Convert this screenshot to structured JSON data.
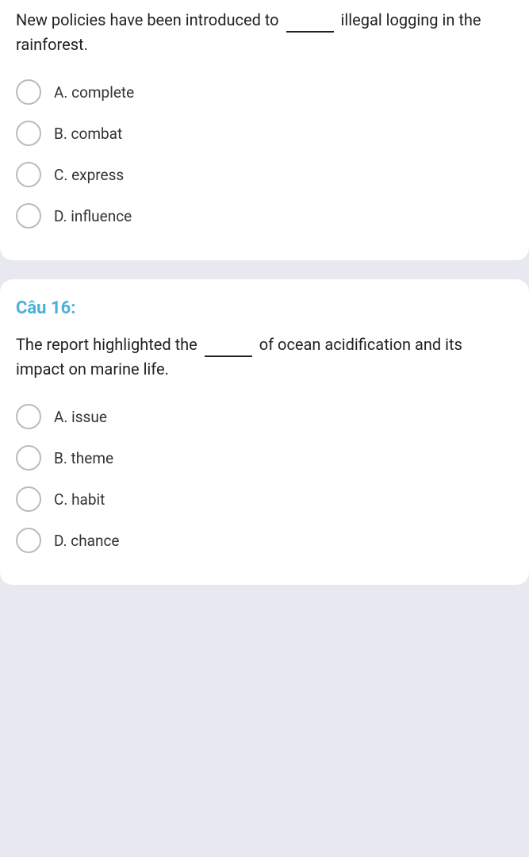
{
  "question15": {
    "text_part1": "New policies have been introduced to",
    "text_part2": "illegal logging in the rainforest.",
    "options": [
      {
        "id": "A",
        "label": "A. complete"
      },
      {
        "id": "B",
        "label": "B. combat"
      },
      {
        "id": "C",
        "label": "C. express"
      },
      {
        "id": "D",
        "label": "D. influence"
      }
    ]
  },
  "question16": {
    "number": "Câu 16:",
    "text_part1": "The report highlighted the",
    "text_part2": "of ocean acidification and its impact on marine life.",
    "options": [
      {
        "id": "A",
        "label": "A. issue"
      },
      {
        "id": "B",
        "label": "B. theme"
      },
      {
        "id": "C",
        "label": "C. habit"
      },
      {
        "id": "D",
        "label": "D. chance"
      }
    ]
  }
}
